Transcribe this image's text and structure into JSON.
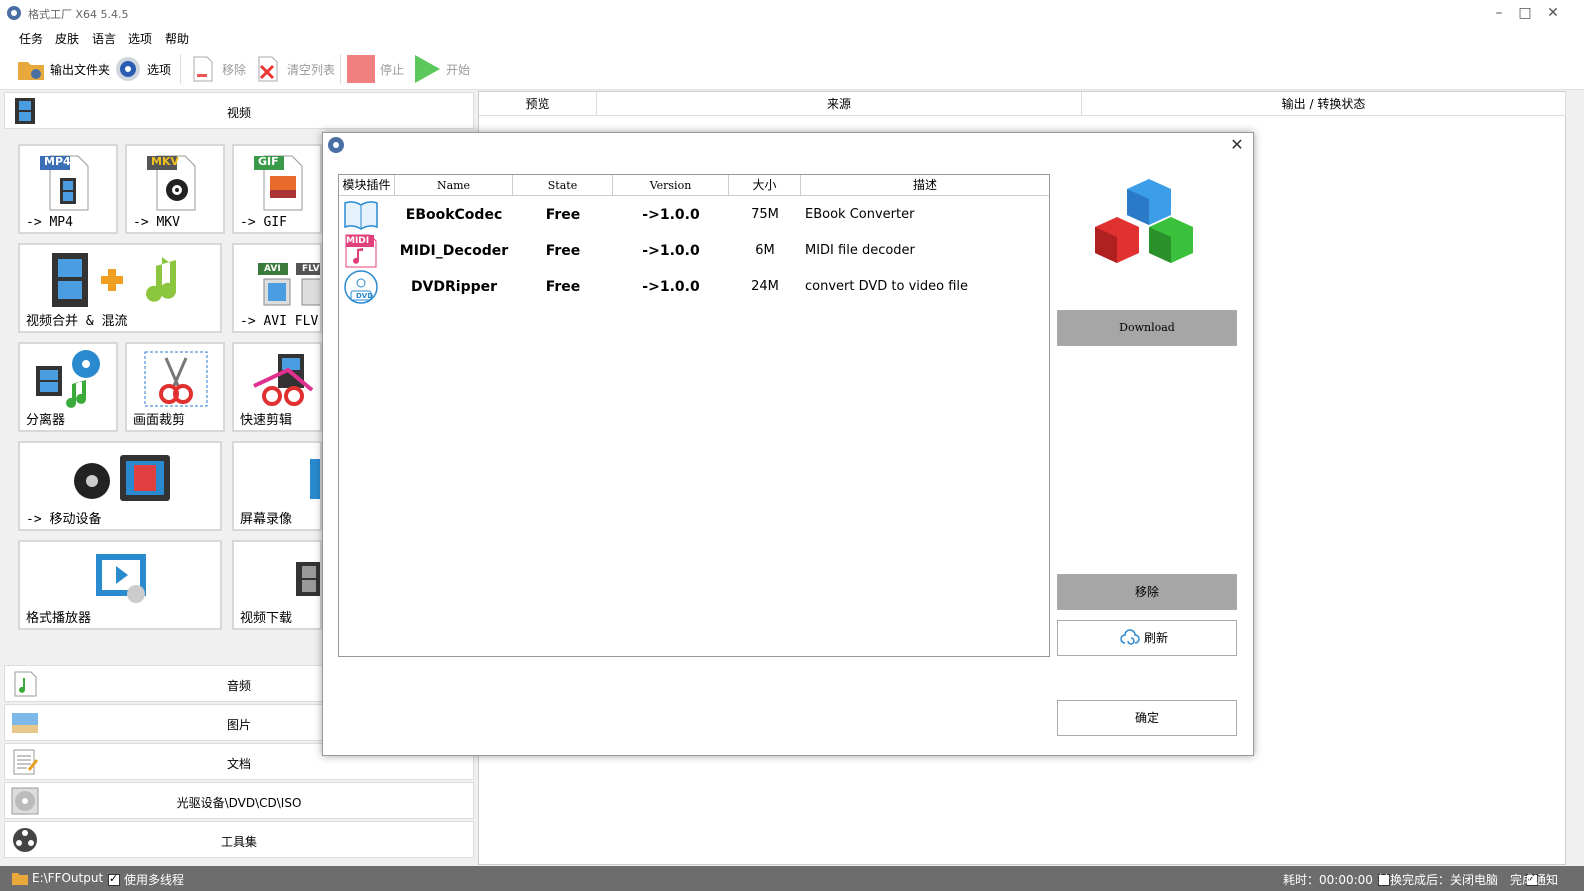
{
  "app": {
    "title": "格式工厂 X64 5.4.5"
  },
  "window_controls": {
    "minimize": "–",
    "maximize": "□",
    "close": "✕"
  },
  "menu": [
    "任务",
    "皮肤",
    "语言",
    "选项",
    "帮助"
  ],
  "toolbar": {
    "output_folder": "输出文件夹",
    "options": "选项",
    "remove": "移除",
    "clear_list": "清空列表",
    "stop": "停止",
    "start": "开始"
  },
  "sidebar": {
    "video_header": "视频",
    "tiles": {
      "mp4": {
        "label": "-> MP4",
        "badge": "MP4"
      },
      "mkv": {
        "label": "-> MKV",
        "badge": "MKV"
      },
      "gif": {
        "label": "-> GIF",
        "badge": "GIF"
      },
      "merge": {
        "label": "视频合并 & 混流"
      },
      "avi": {
        "label": "-> AVI FLV M",
        "badge1": "AVI",
        "badge2": "FLV"
      },
      "splitter": {
        "label": "分离器"
      },
      "crop": {
        "label": "画面裁剪"
      },
      "quickcut": {
        "label": "快速剪辑"
      },
      "mobile": {
        "label": "-> 移动设备"
      },
      "screenrec": {
        "label": "屏幕录像"
      },
      "player": {
        "label": "格式播放器"
      },
      "download": {
        "label": "视频下载"
      }
    },
    "categories": {
      "audio": "音频",
      "image": "图片",
      "document": "文档",
      "disc": "光驱设备\\DVD\\CD\\ISO",
      "tools": "工具集"
    }
  },
  "task_table": {
    "columns": [
      "预览",
      "来源",
      "输出 / 转换状态"
    ]
  },
  "statusbar": {
    "output_path": "E:\\FFOutput",
    "multithread_label": "使用多线程",
    "multithread_checked": true,
    "elapsed": "耗时：00:00:00",
    "after_convert": "转换完成后：关闭电脑",
    "after_convert_checked": false,
    "notify": "完成通知",
    "notify_checked": true
  },
  "dialog": {
    "close": "✕",
    "columns": [
      "模块插件",
      "Name",
      "State",
      "Version",
      "大小",
      "描述"
    ],
    "plugins": [
      {
        "name": "EBookCodec",
        "state": "Free",
        "version": "->1.0.0",
        "size": "75M",
        "desc": "EBook Converter",
        "icon": "ebook-icon"
      },
      {
        "name": "MIDI_Decoder",
        "state": "Free",
        "version": "->1.0.0",
        "size": "6M",
        "desc": "MIDI file decoder",
        "icon": "midi-icon",
        "icon_text": "MIDI"
      },
      {
        "name": "DVDRipper",
        "state": "Free",
        "version": "->1.0.0",
        "size": "24M",
        "desc": "convert DVD to video file",
        "icon": "dvd-icon",
        "icon_text": "DVD"
      }
    ],
    "buttons": {
      "download": "Download",
      "remove": "移除",
      "refresh": "刷新",
      "ok": "确定"
    }
  },
  "colors": {
    "statusbar_bg": "#6d6d6d",
    "button_gray": "#a6a6a6",
    "stop_red": "#f08080",
    "start_green": "#5cc85c"
  }
}
